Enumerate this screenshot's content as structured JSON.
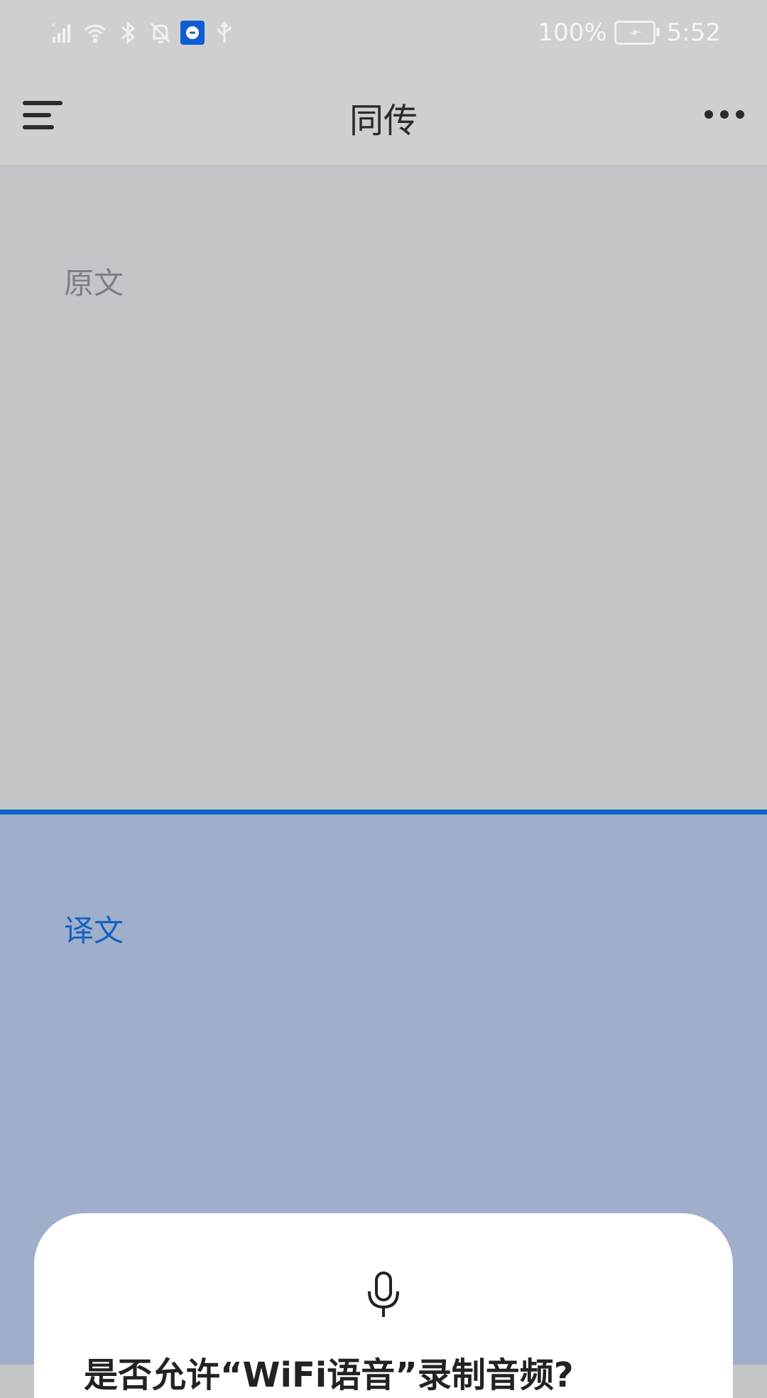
{
  "status_bar": {
    "battery_percent": "100%",
    "time": "5:52"
  },
  "app_bar": {
    "title": "同传"
  },
  "source": {
    "label": "原文"
  },
  "target": {
    "label": "译文"
  },
  "sheet": {
    "prompt": "是否允许“WiFi语音”录制音频?"
  },
  "colors": {
    "accent": "#0d63c9",
    "target_bg": "#9fafc9"
  }
}
